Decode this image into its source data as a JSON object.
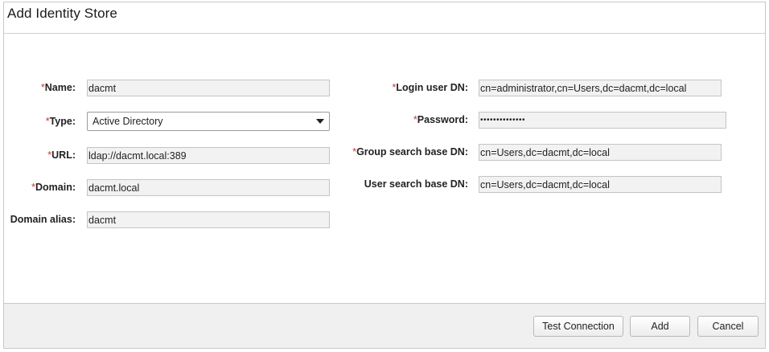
{
  "dialog": {
    "title": "Add Identity Store"
  },
  "required_marker": "*",
  "left_fields": {
    "name": {
      "label": "Name:",
      "value": "dacmt"
    },
    "type": {
      "label": "Type:",
      "selected": "Active Directory"
    },
    "url": {
      "label": "URL:",
      "value": "ldap://dacmt.local:389"
    },
    "domain": {
      "label": "Domain:",
      "value": "dacmt.local"
    },
    "domain_alias": {
      "label": "Domain alias:",
      "value": "dacmt"
    }
  },
  "right_fields": {
    "login_user_dn": {
      "label": "Login user DN:",
      "value": "cn=administrator,cn=Users,dc=dacmt,dc=local"
    },
    "password": {
      "label": "Password:",
      "value": "••••••••••••••"
    },
    "group_search_base_dn": {
      "label": "Group search base DN:",
      "value": "cn=Users,dc=dacmt,dc=local"
    },
    "user_search_base_dn": {
      "label": "User search base DN:",
      "value": "cn=Users,dc=dacmt,dc=local"
    }
  },
  "footer": {
    "test_connection": "Test Connection",
    "add": "Add",
    "cancel": "Cancel"
  },
  "colors": {
    "required": "#c0392b",
    "field_bg": "#f2f2f2",
    "footer_bg": "#f0f0f0"
  }
}
